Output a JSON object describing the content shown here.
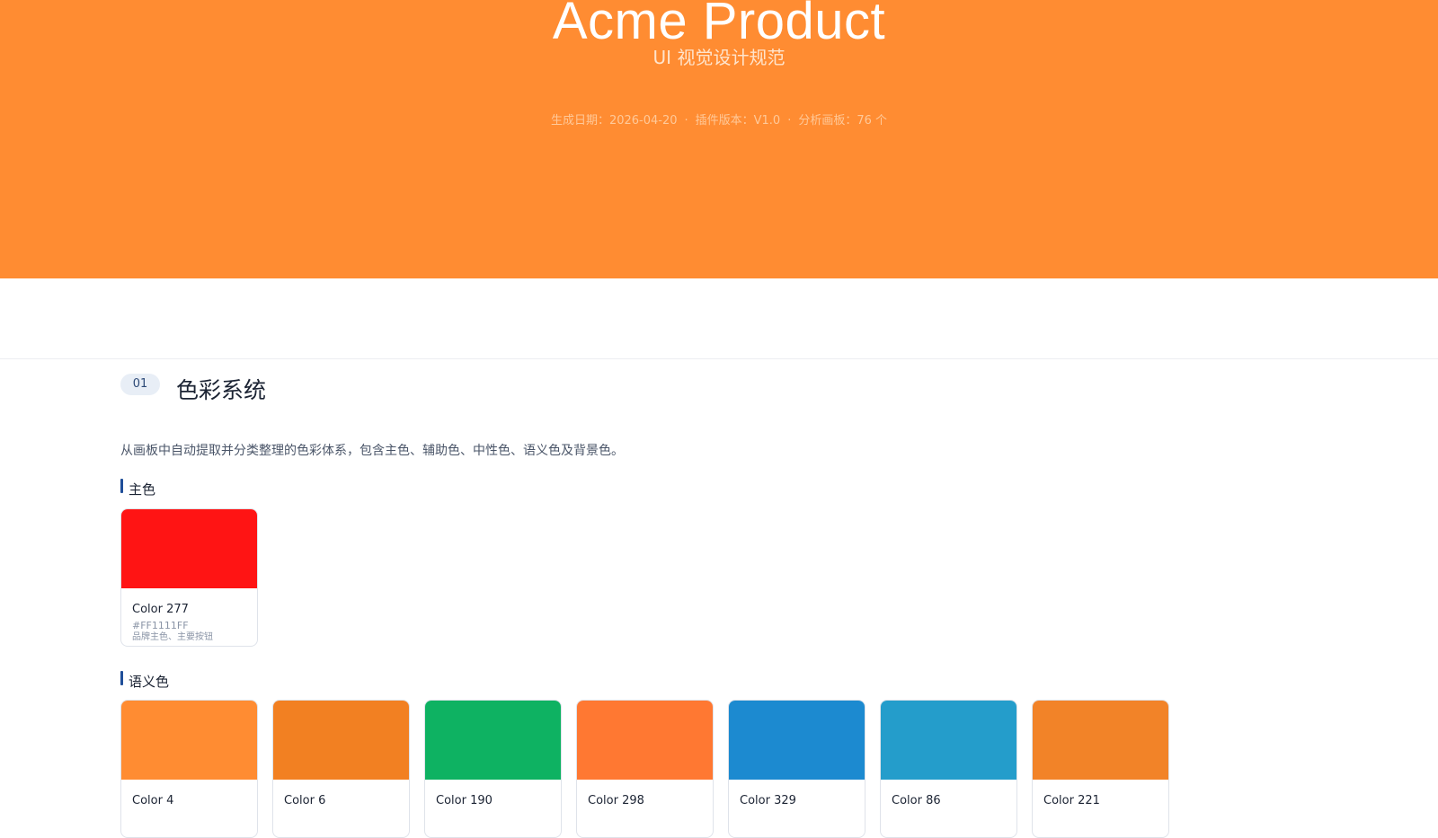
{
  "hero": {
    "title": "Acme Product",
    "subtitle": "UI 视觉设计规范",
    "meta": {
      "date": "生成日期：2026-04-20",
      "sep1": "·",
      "version": "插件版本：V1.0",
      "sep2": "·",
      "boards": "分析画板：76 个"
    }
  },
  "section": {
    "number": "01",
    "title": "色彩系统",
    "description": "从画板中自动提取并分类整理的色彩体系，包含主色、辅助色、中性色、语义色及背景色。"
  },
  "primary": {
    "title": "主色",
    "cards": [
      {
        "name": "Color 277",
        "hex": "#FF1111FF",
        "usage": "品牌主色、主要按钮",
        "color": "#ff1414"
      }
    ]
  },
  "semantic": {
    "title": "语义色",
    "cards": [
      {
        "name": "Color 4",
        "color": "#ff8c32"
      },
      {
        "name": "Color 6",
        "color": "#f28022"
      },
      {
        "name": "Color 190",
        "color": "#0eb262"
      },
      {
        "name": "Color 298",
        "color": "#ff7832"
      },
      {
        "name": "Color 329",
        "color": "#1c8ad0"
      },
      {
        "name": "Color 86",
        "color": "#249dcb"
      },
      {
        "name": "Color 221",
        "color": "#f28328"
      }
    ]
  }
}
